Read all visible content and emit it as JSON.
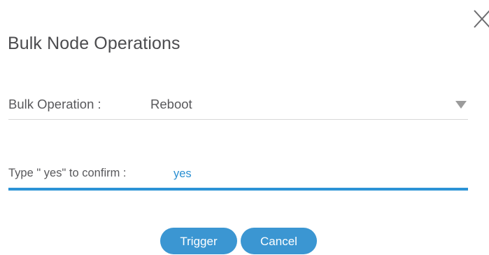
{
  "dialog": {
    "title": "Bulk Node Operations",
    "close_icon": "close-icon"
  },
  "operation": {
    "label": "Bulk Operation :",
    "value": "Reboot",
    "dropdown_icon": "caret-down-icon"
  },
  "confirm": {
    "label": "Type \" yes\"  to confirm :",
    "value": "yes"
  },
  "buttons": {
    "trigger_label": "Trigger",
    "cancel_label": "Cancel"
  },
  "colors": {
    "accent": "#2c93d6",
    "button_bg": "#3b96d2",
    "text": "#58585b",
    "input_text": "#2a8fd2"
  }
}
